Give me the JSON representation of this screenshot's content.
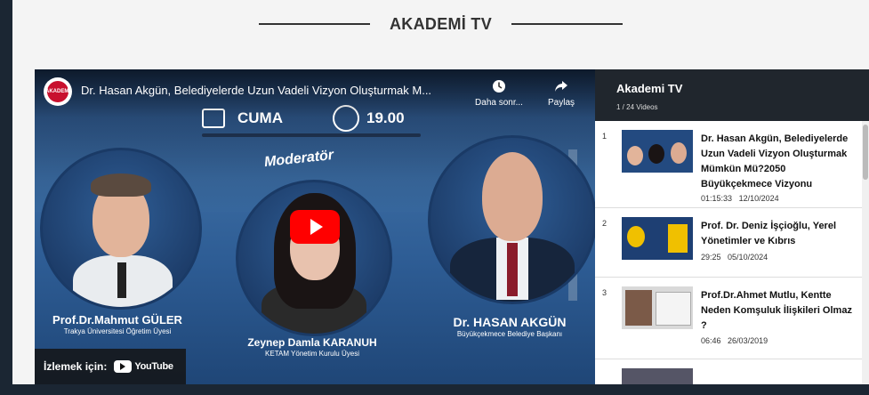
{
  "section": {
    "title": "AKADEMİ TV"
  },
  "player": {
    "video_title": "Dr. Hasan Akgün, Belediyelerde Uzun Vadeli Vizyon Oluşturmak M...",
    "watch_later_label": "Daha sonr...",
    "share_label": "Paylaş",
    "channel_logo_text": "AKADEMİ",
    "day": "CUMA",
    "time": "19.00",
    "moderator_heading": "Moderatör",
    "speakers": [
      {
        "name": "Prof.Dr.Mahmut GÜLER",
        "subtitle": "Trakya Üniversitesi Öğretim Üyesi"
      },
      {
        "name": "Zeynep Damla KARANUH",
        "subtitle": "KETAM Yönetim Kurulu Üyesi"
      },
      {
        "name": "Dr. HASAN AKGÜN",
        "subtitle": "Büyükçekmece Belediye Başkanı"
      }
    ],
    "watch_on_label": "İzlemek için:",
    "youtube_word": "YouTube"
  },
  "playlist": {
    "title": "Akademi TV",
    "count": "1 / 24 Videos",
    "items": [
      {
        "index": "1",
        "title": "Dr. Hasan Akgün, Belediyelerde Uzun Vadeli Vizyon Oluşturmak Mümkün Mü?2050 Büyükçekmece Vizyonu",
        "duration": "01:15:33",
        "date": "12/10/2024"
      },
      {
        "index": "2",
        "title": "Prof. Dr. Deniz İşçioğlu, Yerel Yönetimler ve Kıbrıs",
        "duration": "29:25",
        "date": "05/10/2024"
      },
      {
        "index": "3",
        "title": "Prof.Dr.Ahmet Mutlu, Kentte Neden Komşuluk İlişkileri Olmaz ?",
        "duration": "06:46",
        "date": "26/03/2019"
      }
    ]
  },
  "colors": {
    "page_bg": "#1b2633",
    "header_bg": "#20262d",
    "play_red": "#ff0000"
  }
}
